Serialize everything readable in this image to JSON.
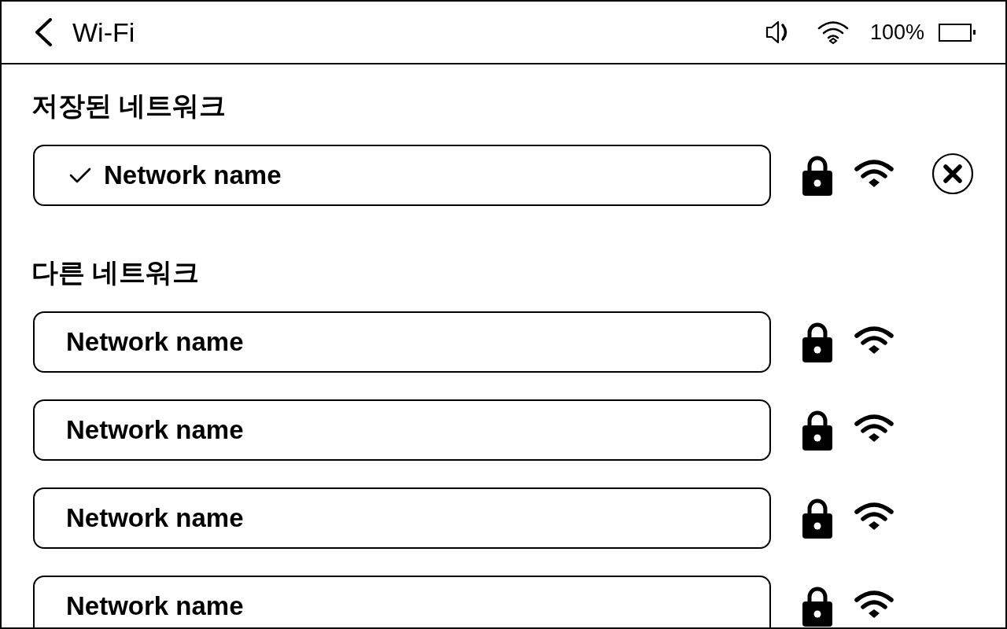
{
  "header": {
    "title": "Wi-Fi",
    "volume_on": true,
    "battery_text": "100%",
    "battery": {
      "level": 1
    }
  },
  "sections": [
    {
      "title": "저장된 네트워크",
      "networks": [
        {
          "name": "Network name",
          "connected": true,
          "secured": true,
          "removable": true
        }
      ]
    },
    {
      "title": "다른 네트워크",
      "networks": [
        {
          "name": "Network name",
          "connected": false,
          "secured": true,
          "removable": false
        },
        {
          "name": "Network name",
          "connected": false,
          "secured": true,
          "removable": false
        },
        {
          "name": "Network name",
          "connected": false,
          "secured": true,
          "removable": false
        },
        {
          "name": "Network name",
          "connected": false,
          "secured": true,
          "removable": false
        }
      ]
    }
  ]
}
